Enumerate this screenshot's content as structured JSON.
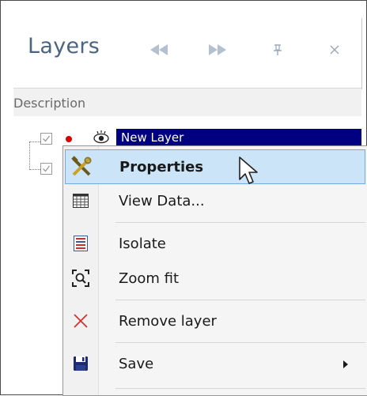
{
  "panel": {
    "title": "Layers",
    "buttons": {
      "back": "rewind-icon",
      "forward": "fast-forward-icon",
      "pin": "pin-icon",
      "close": "close-icon"
    }
  },
  "columns": {
    "description": "Description"
  },
  "tree": {
    "layers": [
      {
        "name": "New Layer",
        "checked": true,
        "selected": true
      },
      {
        "name": "",
        "checked": true,
        "selected": false
      }
    ]
  },
  "context_menu": {
    "items": [
      {
        "label": "Properties",
        "icon": "properties-tools-icon",
        "bold": true,
        "hover": true
      },
      {
        "label": "View Data...",
        "icon": "table-grid-icon"
      },
      {
        "label": "Isolate",
        "icon": "isolate-icon"
      },
      {
        "label": "Zoom fit",
        "icon": "zoom-fit-icon"
      },
      {
        "label": "Remove layer",
        "icon": "remove-x-icon"
      },
      {
        "label": "Save",
        "icon": "save-disk-icon",
        "submenu": true
      }
    ]
  },
  "colors": {
    "title": "#4a6481",
    "selection": "#000080",
    "menu_hover": "#cce4f7",
    "menu_hover_border": "#6fa9dd",
    "remove_red": "#d42a2a"
  }
}
